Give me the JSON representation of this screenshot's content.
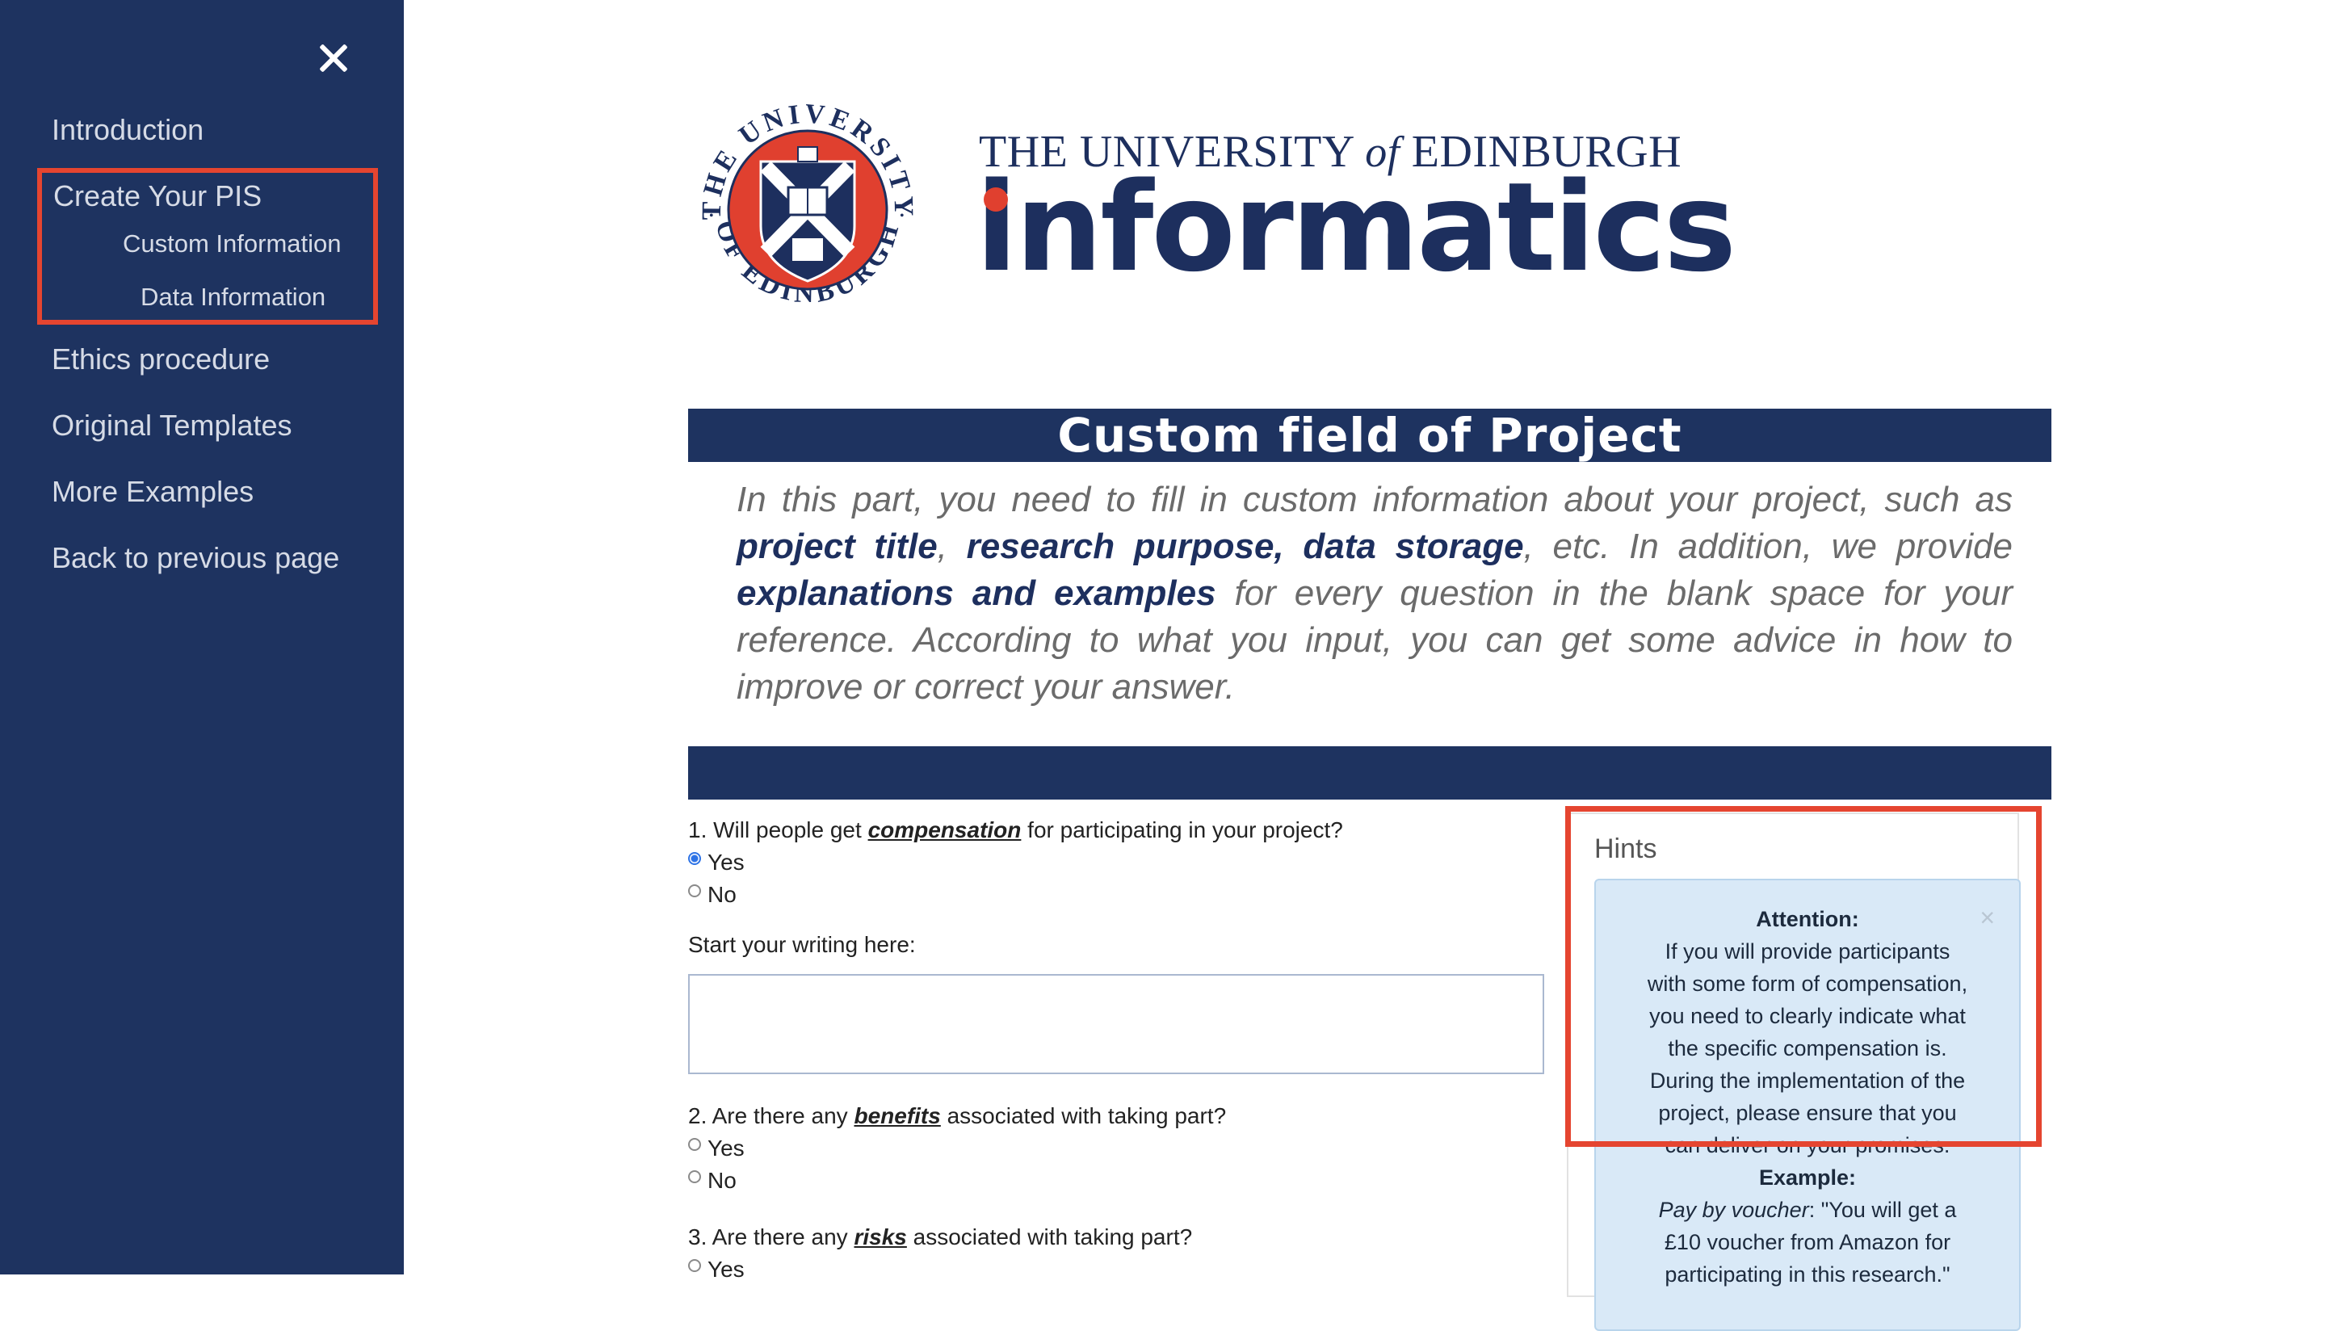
{
  "sidebar": {
    "close_icon": "close-icon",
    "items": [
      {
        "label": "Introduction"
      },
      {
        "label": "Create Your PIS"
      },
      {
        "label": "Custom Information"
      },
      {
        "label": "Data Information"
      },
      {
        "label": "Ethics procedure"
      },
      {
        "label": "Original Templates"
      },
      {
        "label": "More Examples"
      },
      {
        "label": "Back to previous page"
      }
    ]
  },
  "header": {
    "university_pre": "THE UNIVERSITY ",
    "university_of": "of",
    "university_post": " EDINBURGH",
    "department": "informatics",
    "seal_text_top": "THE UNIVERSITY",
    "seal_text_bottom": "OF EDINBURGH"
  },
  "section": {
    "title": "Custom field of Project",
    "intro": {
      "p1": "In this part, you need to fill in custom information about your project, such as ",
      "k1": "project title",
      "p2": ", ",
      "k2": "research purpose, data storage",
      "p3": ", etc. In addition, we provide ",
      "k3": "explanations and examples",
      "p4": " for every question in the blank space for your reference. According to what you input, you can get some advice in how to improve or correct your answer."
    }
  },
  "questions": [
    {
      "pre": "1. Will people get ",
      "keyword": "compensation",
      "post": " for participating in your project?",
      "options": [
        "Yes",
        "No"
      ],
      "selected": "Yes"
    },
    {
      "pre": "2. Are there any ",
      "keyword": "benefits",
      "post": " associated with taking part?",
      "options": [
        "Yes",
        "No"
      ],
      "selected": null
    },
    {
      "pre": "3. Are there any ",
      "keyword": "risks",
      "post": " associated with taking part?",
      "options": [
        "Yes"
      ],
      "selected": null
    }
  ],
  "writing": {
    "label": "Start your writing here:",
    "value": ""
  },
  "hints": {
    "title": "Hints",
    "close_glyph": "×",
    "attention_heading": "Attention:",
    "attention_lines": [
      "If you will provide participants",
      "with some form of compensation,",
      "you need to clearly indicate what",
      "the specific compensation is.",
      "During the implementation of the",
      "project, please ensure that you",
      "can deliver on your promises."
    ],
    "example_heading": "Example:",
    "example_lead": "Pay by voucher",
    "example_lines": [
      ": \"You will get a",
      "£10 voucher from Amazon for",
      "participating in this research.\""
    ]
  },
  "colors": {
    "navy": "#1e3360",
    "brand_red": "#e0402f",
    "highlight": "#e54530",
    "hint_bg": "#d9e9f7"
  }
}
